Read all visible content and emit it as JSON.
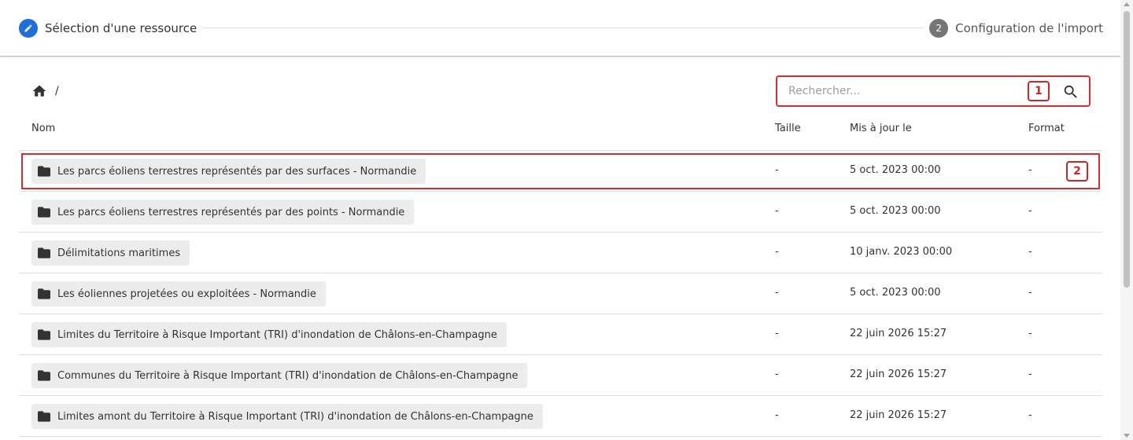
{
  "stepper": {
    "step1": {
      "label": "Sélection d'une ressource",
      "icon": "pencil-icon"
    },
    "step2": {
      "number": "2",
      "label": "Configuration de l'import"
    }
  },
  "toolbar": {
    "breadcrumb_separator": "/",
    "search": {
      "placeholder": "Rechercher...",
      "marker": "1"
    }
  },
  "table": {
    "headers": {
      "name": "Nom",
      "size": "Taille",
      "updated": "Mis à jour le",
      "format": "Format"
    },
    "rows": [
      {
        "name": "Les parcs éoliens terrestres représentés par des surfaces - Normandie",
        "size": "-",
        "updated": "5 oct. 2023 00:00",
        "format": "-",
        "marker": "2"
      },
      {
        "name": "Les parcs éoliens terrestres représentés par des points - Normandie",
        "size": "-",
        "updated": "5 oct. 2023 00:00",
        "format": "-"
      },
      {
        "name": "Délimitations maritimes",
        "size": "-",
        "updated": "10 janv. 2023 00:00",
        "format": "-"
      },
      {
        "name": "Les éoliennes projetées ou exploitées - Normandie",
        "size": "-",
        "updated": "5 oct. 2023 00:00",
        "format": "-"
      },
      {
        "name": "Limites du Territoire à Risque Important (TRI) d'inondation de Châlons-en-Champagne",
        "size": "-",
        "updated": "22 juin 2026 15:27",
        "format": "-"
      },
      {
        "name": "Communes du Territoire à Risque Important (TRI) d'inondation de Châlons-en-Champagne",
        "size": "-",
        "updated": "22 juin 2026 15:27",
        "format": "-"
      },
      {
        "name": "Limites amont du Territoire à Risque Important (TRI) d'inondation de Châlons-en-Champagne",
        "size": "-",
        "updated": "22 juin 2026 15:27",
        "format": "-"
      }
    ]
  },
  "colors": {
    "accent": "#1e6fd9",
    "highlight": "#d32f2f",
    "chip_bg": "#ececec"
  }
}
